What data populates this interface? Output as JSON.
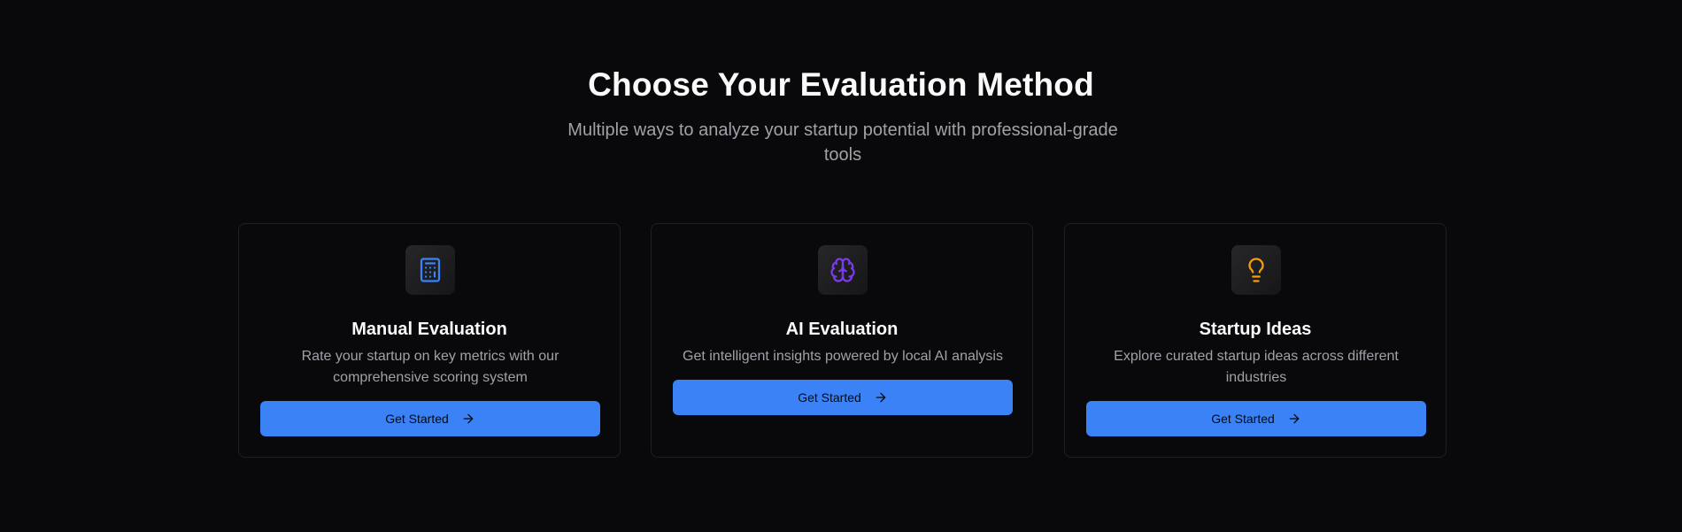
{
  "header": {
    "title": "Choose Your Evaluation Method",
    "subtitle": "Multiple ways to analyze your startup potential with professional-grade tools"
  },
  "cards": [
    {
      "icon": "calculator-icon",
      "icon_color": "#3b82f6",
      "title": "Manual Evaluation",
      "description": "Rate your startup on key metrics with our comprehensive scoring system",
      "button_label": "Get Started"
    },
    {
      "icon": "brain-icon",
      "icon_color": "#7c3aed",
      "title": "AI Evaluation",
      "description": "Get intelligent insights powered by local AI analysis",
      "button_label": "Get Started"
    },
    {
      "icon": "lightbulb-icon",
      "icon_color": "#f59e0b",
      "title": "Startup Ideas",
      "description": "Explore curated startup ideas across different industries",
      "button_label": "Get Started"
    }
  ],
  "colors": {
    "background": "#09090b",
    "card_border": "#1f1f23",
    "button": "#3b82f6",
    "muted_text": "#a1a1aa"
  }
}
